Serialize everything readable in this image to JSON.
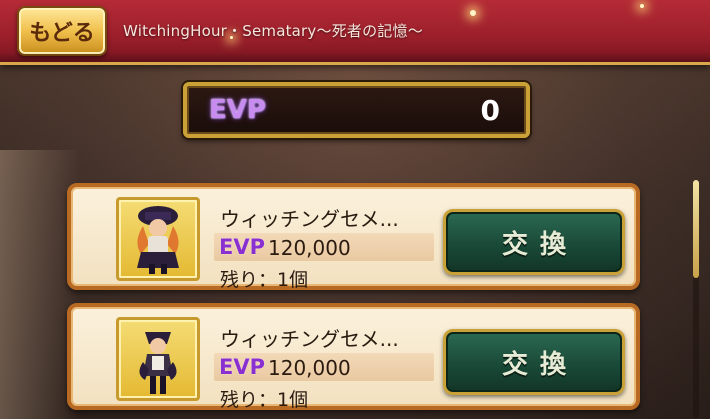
{
  "header": {
    "back_label": "もどる",
    "title": "WitchingHour・Sematary〜死者の記憶〜"
  },
  "evp": {
    "label": "EVP",
    "value": "0"
  },
  "items": [
    {
      "name": "ウィッチングセメ...",
      "currency": "EVP",
      "price": "120,000",
      "remaining": "残り：1個",
      "button": "交換",
      "icon": "orange-haired-costume-figure-icon"
    },
    {
      "name": "ウィッチングセメ...",
      "currency": "EVP",
      "price": "120,000",
      "remaining": "残り：1個",
      "button": "交換",
      "icon": "dark-cloaked-costume-figure-icon"
    }
  ],
  "colors": {
    "header_red": "#9b1f2b",
    "gold_border": "#c9a137",
    "evp_purple": "#8a2fd0",
    "button_green": "#1a4a38",
    "card_bg": "#f2e1c0"
  },
  "scroll": {
    "position_fraction": 0.0
  }
}
